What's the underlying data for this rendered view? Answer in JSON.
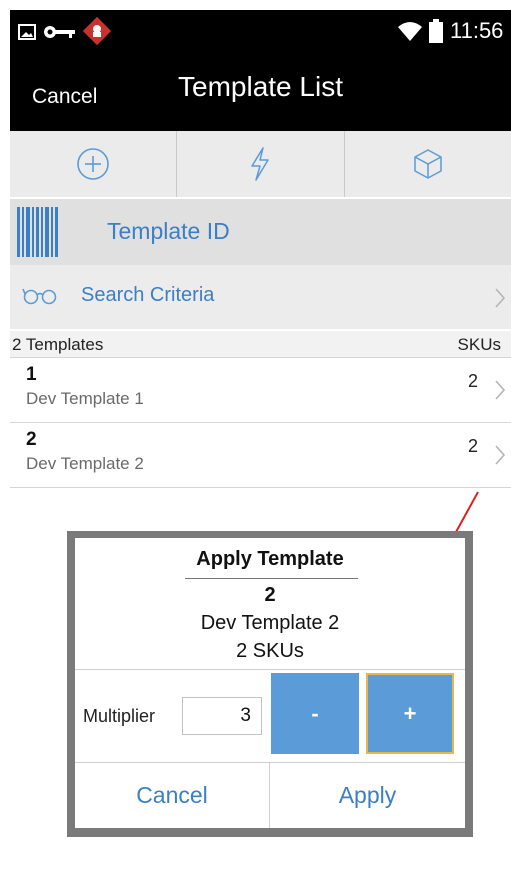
{
  "status_bar": {
    "time": "11:56",
    "left_icons": [
      "image-icon",
      "key-icon",
      "app-notification-icon"
    ],
    "right_icons": [
      "wifi-icon",
      "battery-icon"
    ]
  },
  "nav": {
    "cancel_label": "Cancel",
    "title": "Template List"
  },
  "actions": [
    {
      "icon": "add-circle-icon"
    },
    {
      "icon": "lightning-icon"
    },
    {
      "icon": "cube-icon"
    }
  ],
  "scan": {
    "icon": "barcode-icon",
    "label": "Template ID"
  },
  "search": {
    "icon": "glasses-icon",
    "label": "Search Criteria"
  },
  "list": {
    "count_label": "2 Templates",
    "skus_header": "SKUs",
    "items": [
      {
        "id": "1",
        "name": "Dev Template 1",
        "skus": "2"
      },
      {
        "id": "2",
        "name": "Dev Template 2",
        "skus": "2"
      }
    ]
  },
  "dialog": {
    "title": "Apply Template",
    "template_id": "2",
    "template_name": "Dev Template 2",
    "sku_count": "2 SKUs",
    "multiplier_label": "Multiplier",
    "multiplier_value": "3",
    "minus_label": "-",
    "plus_label": "+",
    "cancel_label": "Cancel",
    "apply_label": "Apply"
  },
  "colors": {
    "accent": "#3b7fc4",
    "stepper": "#5a9bd8",
    "stepper_focus_border": "#e6b84a",
    "annotation_arrow": "#e02020"
  }
}
